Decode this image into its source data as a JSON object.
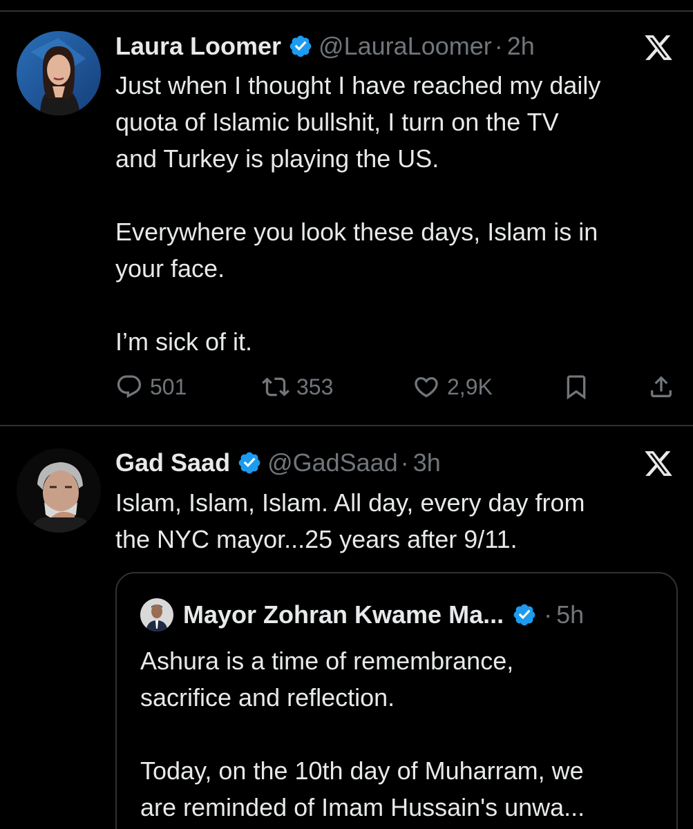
{
  "tweets": [
    {
      "name": "Laura Loomer",
      "handle": "@LauraLoomer",
      "separator": "·",
      "time": "2h",
      "lines": [
        "Just when I thought I have reached my daily",
        "quota of Islamic bullshit, I turn on the TV",
        "and Turkey is playing the US.",
        "Everywhere you look these days, Islam is in",
        "your face.",
        "I’m sick of it."
      ],
      "replies": "501",
      "reposts": "353",
      "likes": "2,9K"
    },
    {
      "name": "Gad Saad",
      "handle": "@GadSaad",
      "separator": "·",
      "time": "3h",
      "lines": [
        "Islam, Islam, Islam. All day, every day from",
        "the NYC mayor...25 years after 9/11."
      ],
      "quote": {
        "name": "Mayor Zohran Kwame Ma...",
        "separator": "·",
        "time": "5h",
        "lines": [
          "Ashura is a time of remembrance,",
          "sacrifice and reflection.",
          "Today, on the 10th day of Muharram, we",
          "are reminded of Imam Hussain's unwa..."
        ]
      }
    }
  ],
  "icons": {
    "verified": "verified-badge-icon",
    "x": "x-logo-icon",
    "reply": "reply-icon",
    "repost": "repost-icon",
    "like": "like-icon",
    "bookmark": "bookmark-icon",
    "share": "share-icon"
  },
  "colors": {
    "background": "#000000",
    "text": "#e7e9ea",
    "muted": "#71767b",
    "verified": "#1d9bf0",
    "divider": "#2f3336"
  }
}
